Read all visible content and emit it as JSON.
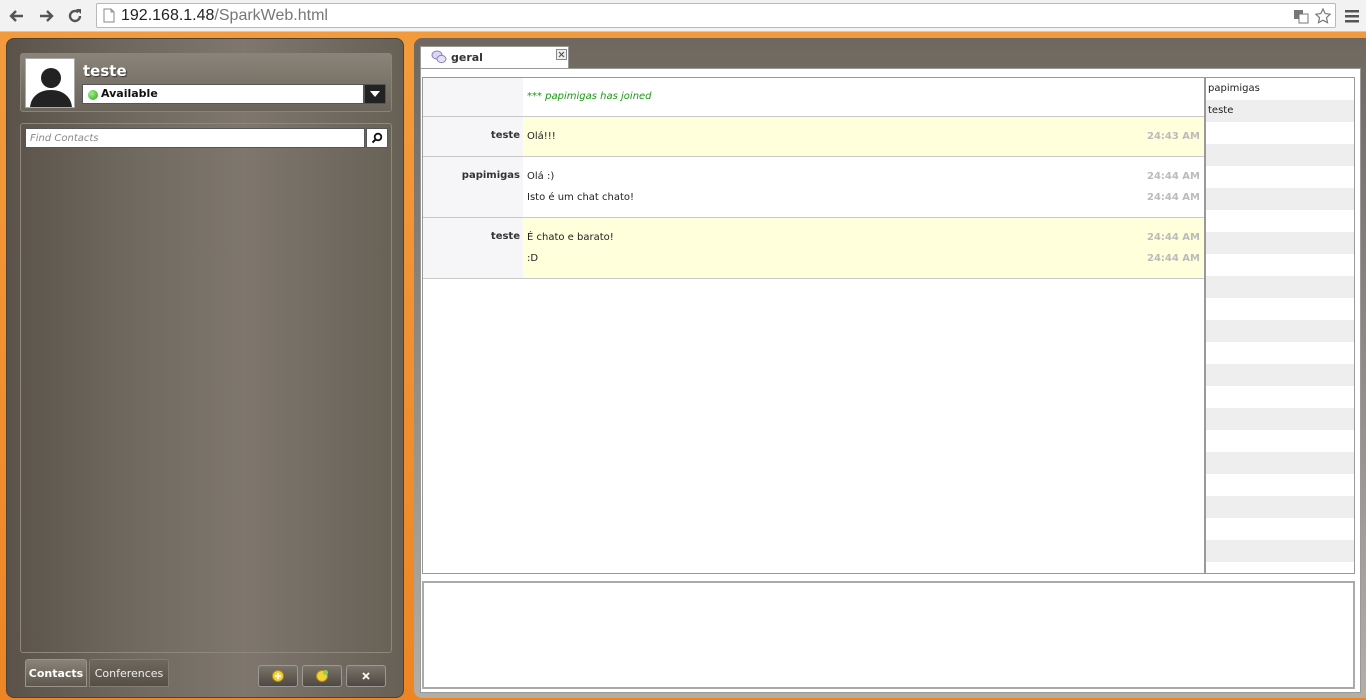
{
  "browser": {
    "url_host": "192.168.1.48",
    "url_path": "/SparkWeb.html"
  },
  "profile": {
    "username": "teste",
    "status": "Available"
  },
  "contacts": {
    "search_placeholder": "Find Contacts",
    "tabs": [
      "Contacts",
      "Conferences"
    ]
  },
  "chat": {
    "tab_label": "geral",
    "system_message": "*** papimigas has joined",
    "groups": [
      {
        "sender": "teste",
        "highlight": true,
        "lines": [
          {
            "text": "Olá!!!",
            "time": "24:43 AM"
          }
        ]
      },
      {
        "sender": "papimigas",
        "highlight": false,
        "lines": [
          {
            "text": "Olá :)",
            "time": "24:44 AM"
          },
          {
            "text": "Isto é um chat chato!",
            "time": "24:44 AM"
          }
        ]
      },
      {
        "sender": "teste",
        "highlight": true,
        "lines": [
          {
            "text": "É chato e barato!",
            "time": "24:44 AM"
          },
          {
            "text": ":D",
            "time": "24:44 AM"
          }
        ]
      }
    ],
    "occupants": [
      "papimigas",
      "teste"
    ]
  },
  "colors": {
    "accent_orange": "#f39b3c",
    "panel_brown": "#6f685f",
    "highlight_yellow": "#ffffdc",
    "system_green": "#1a9a12"
  }
}
